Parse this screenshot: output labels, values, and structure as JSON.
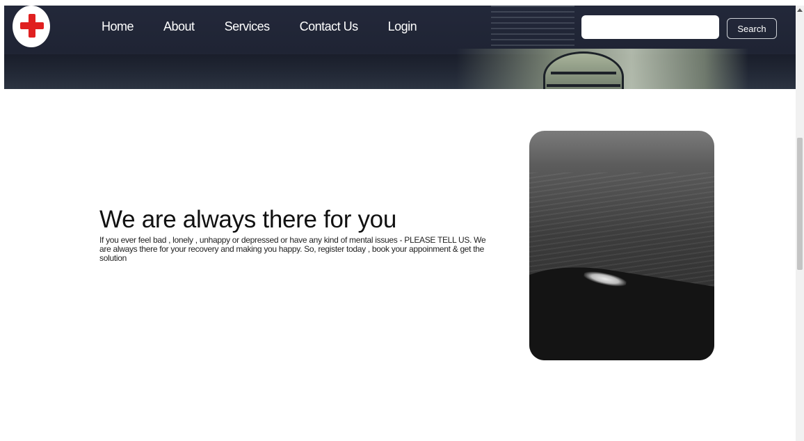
{
  "header": {
    "nav": [
      "Home",
      "About",
      "Services",
      "Contact Us",
      "Login"
    ],
    "search": {
      "value": "",
      "button_label": "Search"
    },
    "logo_icon": "red-cross-icon",
    "colors": {
      "header_bg": "#23283a",
      "logo_cross": "#e02020"
    }
  },
  "hero": {
    "title": "We are always there for you",
    "text": "If you ever feel bad , lonely , unhappy or depressed or have any kind of mental issues - PLEASE TELL US. We are always there for your recovery and making you happy. So, register today , book your appoinment & get the solution"
  }
}
